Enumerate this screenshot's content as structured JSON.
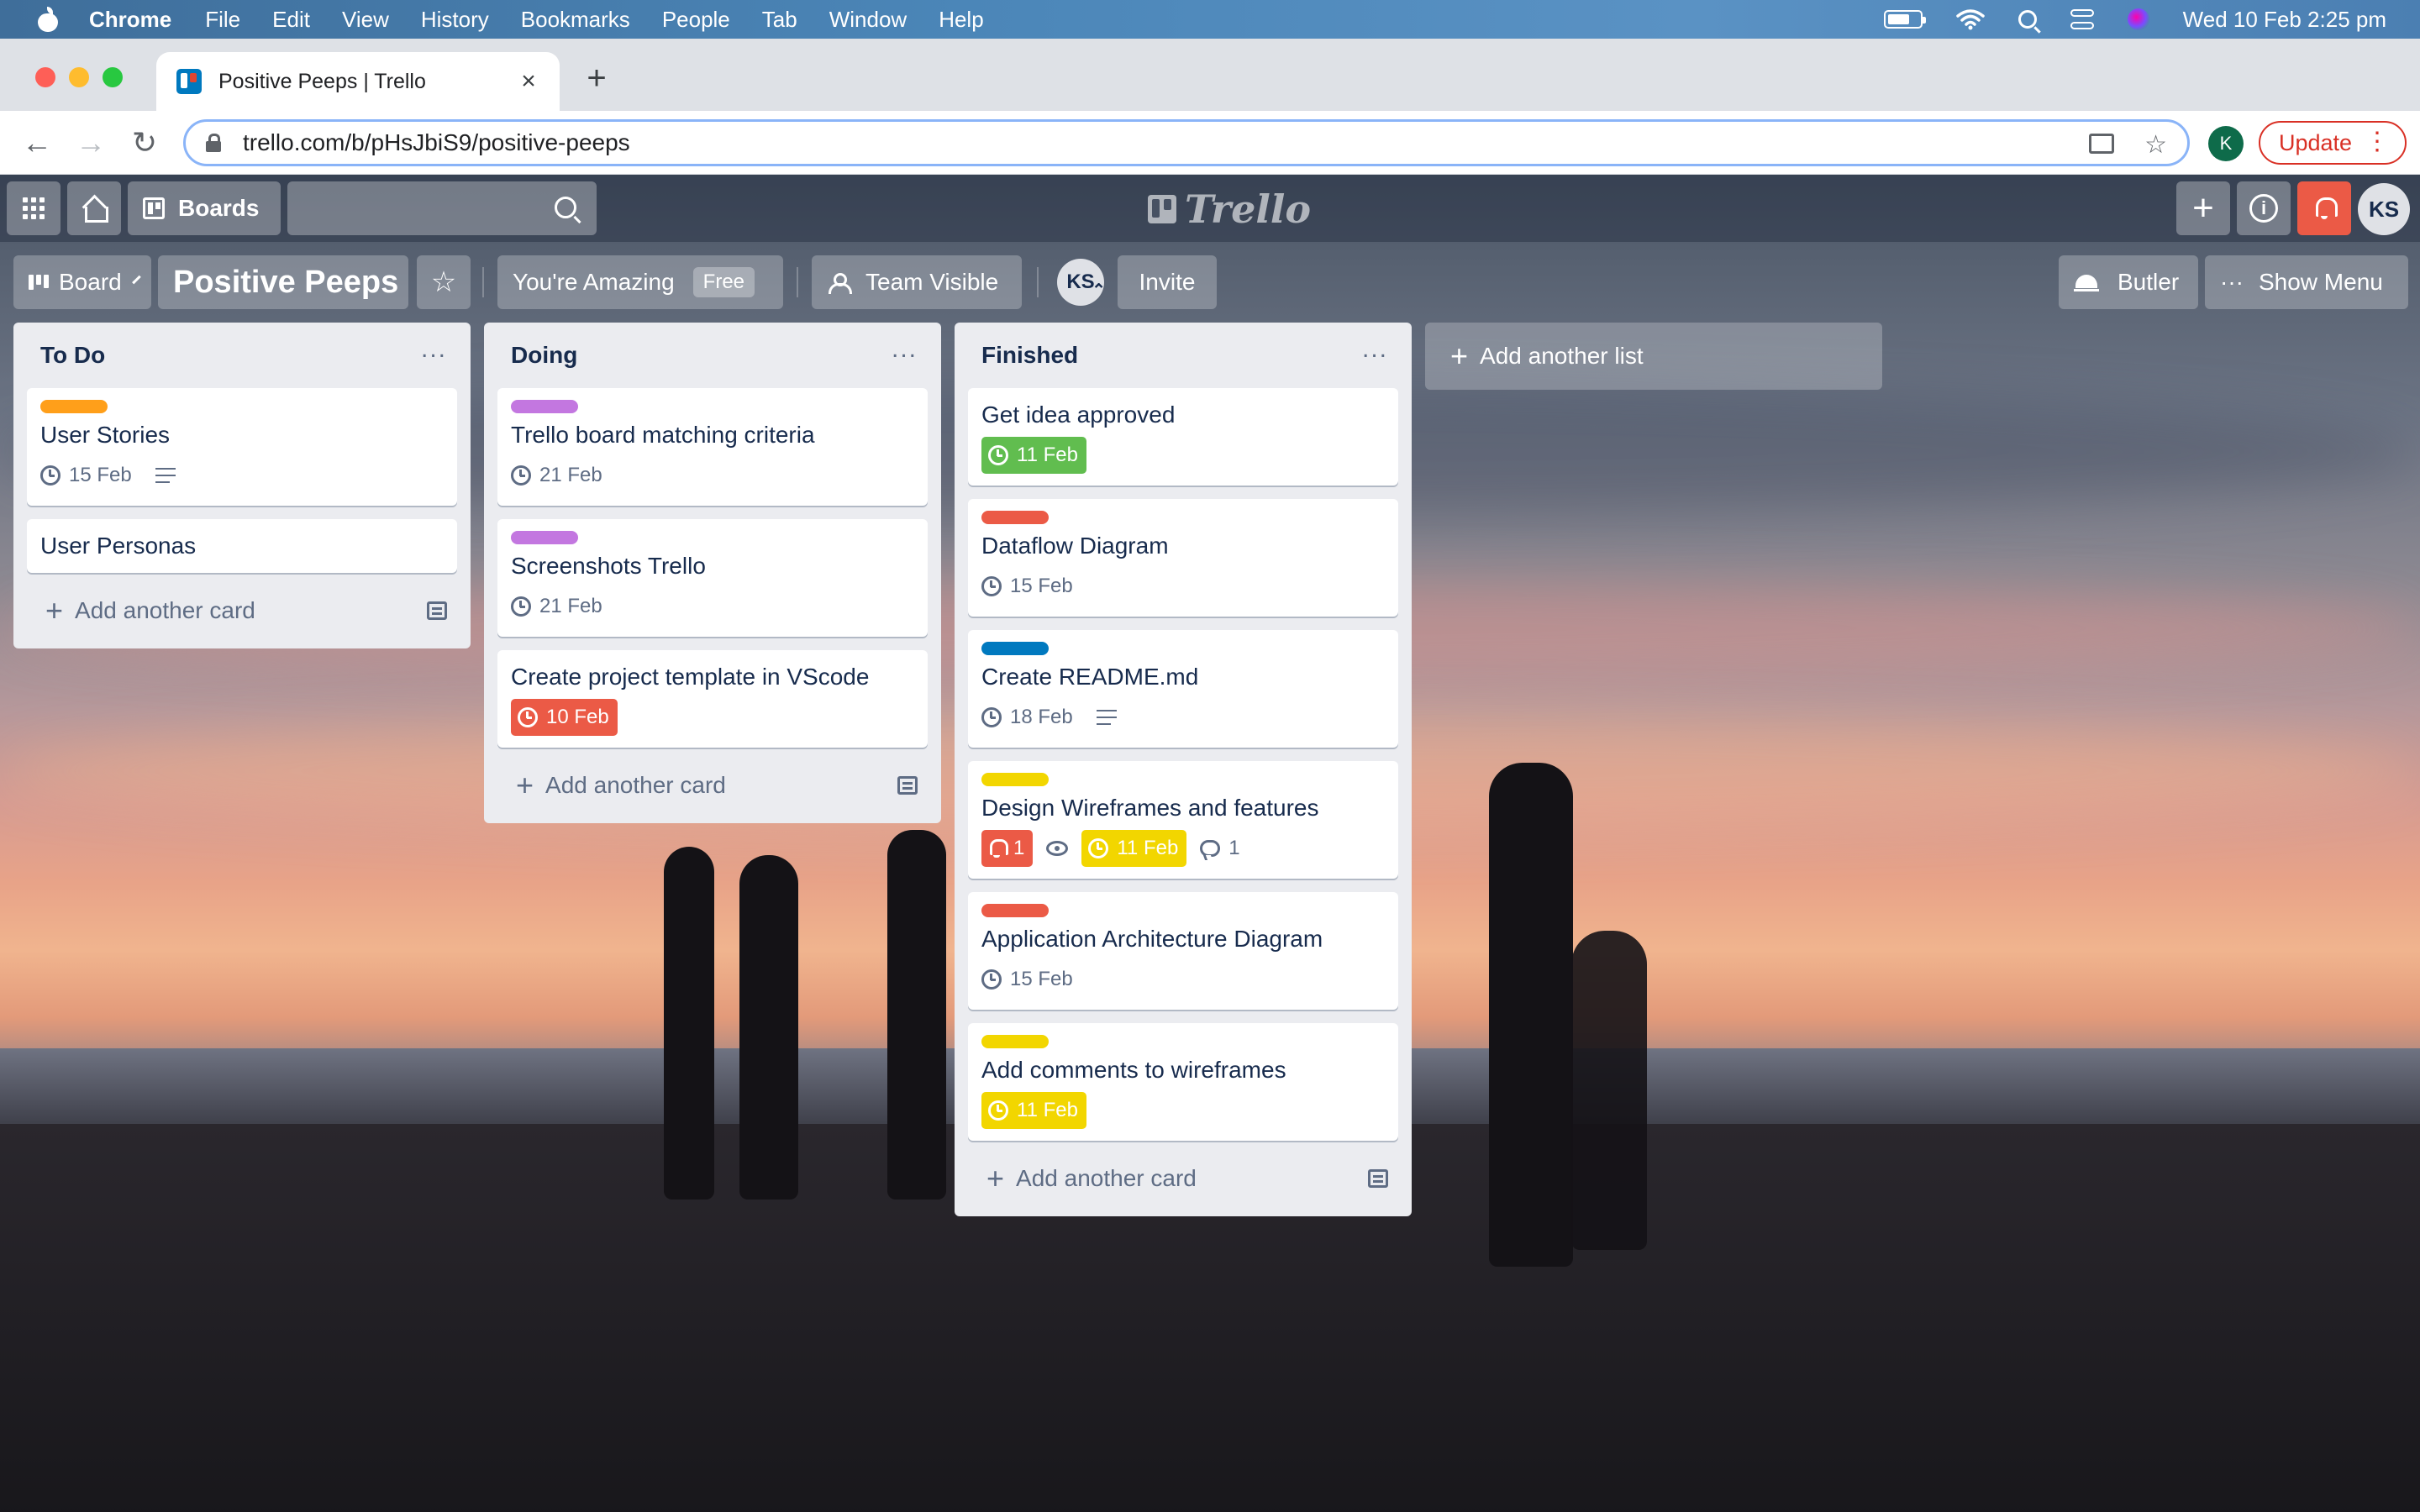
{
  "menubar": {
    "app": "Chrome",
    "items": [
      "File",
      "Edit",
      "View",
      "History",
      "Bookmarks",
      "People",
      "Tab",
      "Window",
      "Help"
    ],
    "datetime": "Wed 10 Feb  2:25 pm"
  },
  "browser": {
    "tab_title": "Positive Peeps | Trello",
    "url": "trello.com/b/pHsJbiS9/positive-peeps",
    "profile_initial": "K",
    "update_label": "Update"
  },
  "trello": {
    "boards_label": "Boards",
    "logo_text": "Trello",
    "avatar": "KS",
    "board": {
      "view_label": "Board",
      "title": "Positive Peeps",
      "team": "You're Amazing",
      "team_badge": "Free",
      "visibility": "Team Visible",
      "member": "KS",
      "invite": "Invite",
      "butler": "Butler",
      "show_menu": "Show Menu",
      "add_list": "Add another list"
    },
    "label_colors": {
      "orange": "#ff9f1a",
      "purple": "#c377e0",
      "red": "#eb5a46",
      "blue": "#0079bf",
      "yellow": "#f2d600"
    },
    "lists": [
      {
        "title": "To Do",
        "add_card": "Add another card",
        "cards": [
          {
            "title": "User Stories",
            "label": "#ff9f1a",
            "due": "15 Feb",
            "due_style": "plain",
            "description": true
          },
          {
            "title": "User Personas"
          }
        ]
      },
      {
        "title": "Doing",
        "add_card": "Add another card",
        "cards": [
          {
            "title": "Trello board matching criteria",
            "label": "#c377e0",
            "due": "21 Feb",
            "due_style": "plain"
          },
          {
            "title": "Screenshots Trello",
            "label": "#c377e0",
            "due": "21 Feb",
            "due_style": "plain"
          },
          {
            "title": "Create project template in VScode",
            "due": "10 Feb",
            "due_style": "red"
          }
        ]
      },
      {
        "title": "Finished",
        "add_card": "Add another card",
        "cards": [
          {
            "title": "Get idea approved",
            "due": "11 Feb",
            "due_style": "green"
          },
          {
            "title": "Dataflow Diagram",
            "label": "#eb5a46",
            "due": "15 Feb",
            "due_style": "plain"
          },
          {
            "title": "Create README.md",
            "label": "#0079bf",
            "due": "18 Feb",
            "due_style": "plain",
            "description": true
          },
          {
            "title": "Design Wireframes and features",
            "label": "#f2d600",
            "notifications": "1",
            "watching": true,
            "due": "11 Feb",
            "due_style": "yellow",
            "comments": "1"
          },
          {
            "title": "Application Architecture Diagram",
            "label": "#eb5a46",
            "due": "15 Feb",
            "due_style": "plain"
          },
          {
            "title": "Add comments to wireframes",
            "label": "#f2d600",
            "due": "11 Feb",
            "due_style": "yellow"
          }
        ]
      }
    ]
  }
}
